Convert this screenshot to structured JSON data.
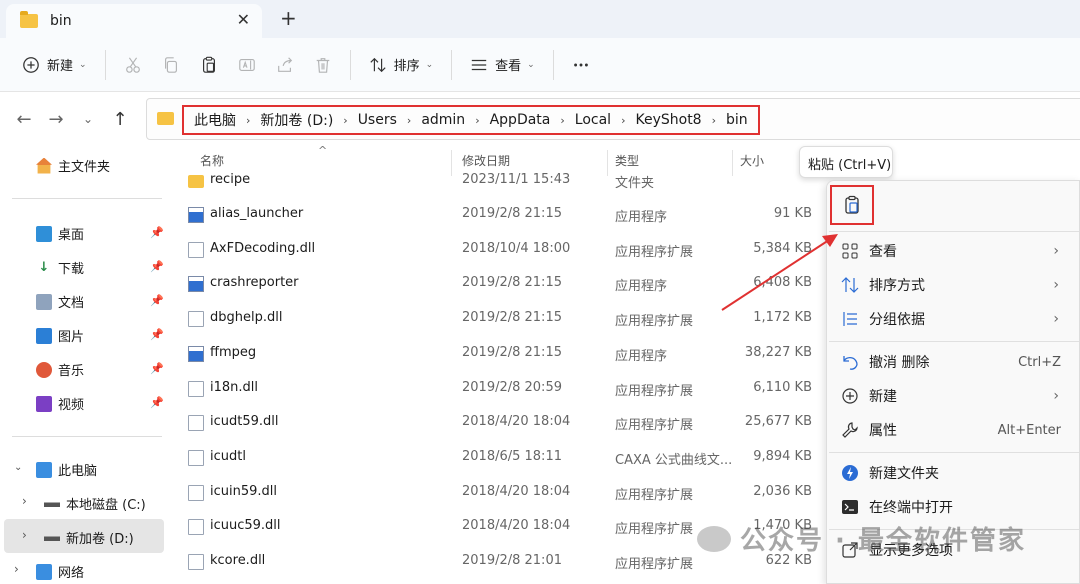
{
  "window": {
    "tab_title": "bin"
  },
  "toolbar": {
    "new_label": "新建",
    "sort_label": "排序",
    "view_label": "查看"
  },
  "address": {
    "crumbs": [
      "此电脑",
      "新加卷 (D:)",
      "Users",
      "admin",
      "AppData",
      "Local",
      "KeyShot8",
      "bin"
    ]
  },
  "nav": {
    "home": "主文件夹",
    "quick": [
      "桌面",
      "下载",
      "文档",
      "图片",
      "音乐",
      "视频"
    ],
    "pc": "此电脑",
    "drives": [
      "本地磁盘 (C:)",
      "新加卷 (D:)"
    ],
    "network": "网络"
  },
  "columns": {
    "name": "名称",
    "date": "修改日期",
    "type": "类型",
    "size": "大小"
  },
  "files": [
    {
      "name": "recipe",
      "date": "2023/11/1 15:43",
      "type": "文件夹",
      "size": "",
      "icon": "folder"
    },
    {
      "name": "alias_launcher",
      "date": "2019/2/8 21:15",
      "type": "应用程序",
      "size": "91 KB",
      "icon": "app"
    },
    {
      "name": "AxFDecoding.dll",
      "date": "2018/10/4 18:00",
      "type": "应用程序扩展",
      "size": "5,384 KB",
      "icon": "dll"
    },
    {
      "name": "crashreporter",
      "date": "2019/2/8 21:15",
      "type": "应用程序",
      "size": "6,408 KB",
      "icon": "app"
    },
    {
      "name": "dbghelp.dll",
      "date": "2019/2/8 21:15",
      "type": "应用程序扩展",
      "size": "1,172 KB",
      "icon": "dll"
    },
    {
      "name": "ffmpeg",
      "date": "2019/2/8 21:15",
      "type": "应用程序",
      "size": "38,227 KB",
      "icon": "app"
    },
    {
      "name": "i18n.dll",
      "date": "2019/2/8 20:59",
      "type": "应用程序扩展",
      "size": "6,110 KB",
      "icon": "dll"
    },
    {
      "name": "icudt59.dll",
      "date": "2018/4/20 18:04",
      "type": "应用程序扩展",
      "size": "25,677 KB",
      "icon": "dll"
    },
    {
      "name": "icudtl",
      "date": "2018/6/5 18:11",
      "type": "CAXA 公式曲线文...",
      "size": "9,894 KB",
      "icon": "dll"
    },
    {
      "name": "icuin59.dll",
      "date": "2018/4/20 18:04",
      "type": "应用程序扩展",
      "size": "2,036 KB",
      "icon": "dll"
    },
    {
      "name": "icuuc59.dll",
      "date": "2018/4/20 18:04",
      "type": "应用程序扩展",
      "size": "1,470 KB",
      "icon": "dll"
    },
    {
      "name": "kcore.dll",
      "date": "2019/2/8 21:01",
      "type": "应用程序扩展",
      "size": "622 KB",
      "icon": "dll"
    }
  ],
  "tooltip": "粘贴 (Ctrl+V)",
  "context_menu": {
    "view": "查看",
    "sort": "排序方式",
    "group": "分组依据",
    "undo": "撤消 删除",
    "undo_key": "Ctrl+Z",
    "new": "新建",
    "props": "属性",
    "props_key": "Alt+Enter",
    "new_folder": "新建文件夹",
    "terminal": "在终端中打开",
    "more": "显示更多选项"
  },
  "watermark": "公众号 · 最全软件管家",
  "colors": {
    "highlight_red": "#e03131",
    "folder_yellow": "#f6c344"
  }
}
